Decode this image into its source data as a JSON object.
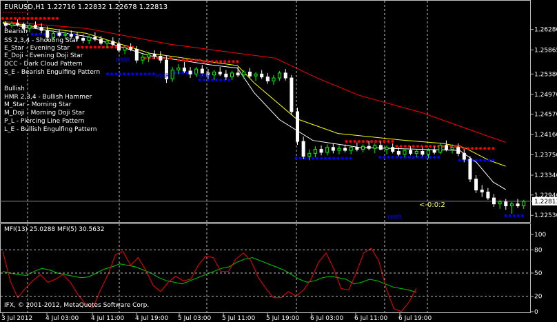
{
  "header": {
    "symbol_line": "EURUSD,H1  1.22716  1.22832  1.22678  1.22813",
    "legend_bearish_title": "Bearish",
    "legend_bearish": [
      "SS 2,3,4 - Shooting Star",
      "E_Star   - Evening Star",
      "E_Doji   - Evening Doji Star",
      "DCC      - Dark Cloud Pattern",
      "S_E      - Bearish Engulfing Pattern"
    ],
    "legend_bullish_title": "Bullish",
    "legend_bullish": [
      "HMR 2,3,4 - Bullish Hammer",
      "M_Star    - Morning Star",
      "M_Doji    - Morning Doji Star",
      "P_L       - Piercing Line Pattern",
      "L_E       - Bullish Engulfing Pattern"
    ],
    "countdown": "<-0:0:2",
    "pattern_tags": [
      "HMR",
      "HMR",
      "HMR",
      "HMR"
    ]
  },
  "indicator": {
    "title": "MFI(13) 25.0288  MFI(5) 30.5632",
    "copyright": "IFX, © 2001-2012, MetaQuotes Software Corp."
  },
  "colors": {
    "background": "#000000",
    "bull_candle": "#00ff00",
    "bear_candle": "#ffffff",
    "red_dots": "#ff0000",
    "blue_dots": "#0000ff",
    "ma_slow": "#ff0000",
    "ma_fast": "#ffffff",
    "ma_mid": "#ffff00",
    "mfi13": "#00cc00",
    "mfi5": "#ff0000"
  },
  "chart_data": [
    {
      "type": "candlestick",
      "title": "EURUSD,H1",
      "ylim": [
        1.2245,
        1.2665
      ],
      "y_ticks": [
        1.2628,
        1.25865,
        1.2538,
        1.2497,
        1.2457,
        1.2416,
        1.2375,
        1.2334,
        1.2294,
        1.22813,
        1.2253
      ],
      "y_tick_labels": [
        "1.26280",
        "1.25865",
        "1.25380",
        "1.24970",
        "1.24570",
        "1.24160",
        "1.23750",
        "1.23340",
        "1.22940",
        "1.22813",
        "1.22530"
      ],
      "current_price": 1.22813,
      "candles": [
        [
          1.264,
          1.2645,
          1.263,
          1.2636
        ],
        [
          1.2636,
          1.2644,
          1.263,
          1.264
        ],
        [
          1.264,
          1.2648,
          1.2634,
          1.2638
        ],
        [
          1.2638,
          1.2642,
          1.2626,
          1.263
        ],
        [
          1.263,
          1.264,
          1.2622,
          1.2636
        ],
        [
          1.2636,
          1.2644,
          1.263,
          1.2632
        ],
        [
          1.2632,
          1.264,
          1.262,
          1.2626
        ],
        [
          1.2626,
          1.2634,
          1.2605,
          1.2612
        ],
        [
          1.2612,
          1.2626,
          1.2606,
          1.262
        ],
        [
          1.262,
          1.2628,
          1.2612,
          1.2616
        ],
        [
          1.2616,
          1.2624,
          1.2608,
          1.2618
        ],
        [
          1.2618,
          1.2626,
          1.261,
          1.2614
        ],
        [
          1.2614,
          1.2622,
          1.2604,
          1.261
        ],
        [
          1.261,
          1.2618,
          1.26,
          1.2606
        ],
        [
          1.2606,
          1.2616,
          1.2598,
          1.2612
        ],
        [
          1.2612,
          1.2622,
          1.2604,
          1.2608
        ],
        [
          1.2608,
          1.2615,
          1.2596,
          1.26
        ],
        [
          1.26,
          1.2608,
          1.259,
          1.2604
        ],
        [
          1.2604,
          1.2612,
          1.2594,
          1.2598
        ],
        [
          1.2598,
          1.2606,
          1.2582,
          1.2586
        ],
        [
          1.2586,
          1.2596,
          1.2578,
          1.2592
        ],
        [
          1.2592,
          1.26,
          1.2584,
          1.2588
        ],
        [
          1.2588,
          1.2594,
          1.256,
          1.2566
        ],
        [
          1.2566,
          1.2578,
          1.2558,
          1.2572
        ],
        [
          1.2572,
          1.2582,
          1.2562,
          1.2578
        ],
        [
          1.2578,
          1.2586,
          1.2568,
          1.2574
        ],
        [
          1.2574,
          1.2584,
          1.256,
          1.2566
        ],
        [
          1.2566,
          1.2574,
          1.252,
          1.2528
        ],
        [
          1.2528,
          1.2552,
          1.2522,
          1.2546
        ],
        [
          1.2546,
          1.2558,
          1.2538,
          1.255
        ],
        [
          1.255,
          1.2562,
          1.254,
          1.2544
        ],
        [
          1.2544,
          1.2552,
          1.253,
          1.2538
        ],
        [
          1.2538,
          1.2552,
          1.2532,
          1.2548
        ],
        [
          1.2548,
          1.2556,
          1.2534,
          1.254
        ],
        [
          1.254,
          1.2548,
          1.2528,
          1.2536
        ],
        [
          1.2536,
          1.2546,
          1.2526,
          1.2542
        ],
        [
          1.2542,
          1.2552,
          1.2534,
          1.2538
        ],
        [
          1.2538,
          1.2546,
          1.2526,
          1.2532
        ],
        [
          1.2532,
          1.2544,
          1.2526,
          1.254
        ],
        [
          1.254,
          1.2552,
          1.2532,
          1.2536
        ],
        [
          1.2536,
          1.2546,
          1.2528,
          1.2542
        ],
        [
          1.2542,
          1.255,
          1.253,
          1.2534
        ],
        [
          1.2534,
          1.2542,
          1.2524,
          1.2538
        ],
        [
          1.2538,
          1.2546,
          1.2528,
          1.2532
        ],
        [
          1.2532,
          1.254,
          1.2518,
          1.2524
        ],
        [
          1.2524,
          1.2536,
          1.2516,
          1.253
        ],
        [
          1.253,
          1.2544,
          1.2524,
          1.254
        ],
        [
          1.254,
          1.2548,
          1.2525,
          1.253
        ],
        [
          1.253,
          1.2536,
          1.2455,
          1.2462
        ],
        [
          1.2462,
          1.247,
          1.2395,
          1.2402
        ],
        [
          1.2402,
          1.2412,
          1.2366,
          1.2372
        ],
        [
          1.2372,
          1.2386,
          1.2364,
          1.2378
        ],
        [
          1.2378,
          1.2392,
          1.237,
          1.2386
        ],
        [
          1.2386,
          1.2394,
          1.2374,
          1.238
        ],
        [
          1.238,
          1.2396,
          1.2374,
          1.239
        ],
        [
          1.239,
          1.2398,
          1.2378,
          1.2384
        ],
        [
          1.2384,
          1.2394,
          1.2376,
          1.2388
        ],
        [
          1.2388,
          1.2396,
          1.238,
          1.2384
        ],
        [
          1.2384,
          1.2392,
          1.2376,
          1.239
        ],
        [
          1.239,
          1.24,
          1.2382,
          1.2386
        ],
        [
          1.2386,
          1.2396,
          1.238,
          1.2392
        ],
        [
          1.2392,
          1.2402,
          1.2384,
          1.2388
        ],
        [
          1.2388,
          1.2398,
          1.2378,
          1.2394
        ],
        [
          1.2394,
          1.2402,
          1.2384,
          1.2386
        ],
        [
          1.2386,
          1.2394,
          1.2376,
          1.239
        ],
        [
          1.239,
          1.2398,
          1.2378,
          1.2382
        ],
        [
          1.2382,
          1.239,
          1.2372,
          1.2376
        ],
        [
          1.2376,
          1.2388,
          1.237,
          1.2384
        ],
        [
          1.2384,
          1.2392,
          1.2374,
          1.2378
        ],
        [
          1.2378,
          1.2386,
          1.237,
          1.2382
        ],
        [
          1.2382,
          1.239,
          1.2372,
          1.2376
        ],
        [
          1.2376,
          1.2388,
          1.2368,
          1.2384
        ],
        [
          1.2384,
          1.2392,
          1.2376,
          1.238
        ],
        [
          1.238,
          1.2398,
          1.2376,
          1.2394
        ],
        [
          1.2394,
          1.2404,
          1.2382,
          1.2386
        ],
        [
          1.2386,
          1.2396,
          1.2378,
          1.239
        ],
        [
          1.239,
          1.2398,
          1.2372,
          1.2378
        ],
        [
          1.2378,
          1.2386,
          1.236,
          1.2366
        ],
        [
          1.2366,
          1.2372,
          1.232,
          1.2326
        ],
        [
          1.2326,
          1.2334,
          1.2298,
          1.2304
        ],
        [
          1.2304,
          1.2314,
          1.229,
          1.23
        ],
        [
          1.23,
          1.2308,
          1.2284,
          1.2288
        ],
        [
          1.2288,
          1.2296,
          1.227,
          1.2276
        ],
        [
          1.2276,
          1.2284,
          1.2266,
          1.228
        ],
        [
          1.228,
          1.2286,
          1.2264,
          1.2272
        ],
        [
          1.2272,
          1.228,
          1.2256,
          1.2276
        ],
        [
          1.2276,
          1.2286,
          1.2268,
          1.2272
        ],
        [
          1.2272,
          1.2284,
          1.2266,
          1.2281
        ]
      ],
      "resistance_dots": [
        [
          0,
          1.265
        ],
        [
          26,
          1.265
        ],
        [
          36,
          1.2592
        ],
        [
          62,
          1.2592
        ],
        [
          68,
          1.257
        ],
        [
          80,
          1.257
        ],
        [
          84,
          1.2566
        ],
        [
          94,
          1.2566
        ],
        [
          96,
          1.2563
        ],
        [
          112,
          1.2563
        ],
        [
          164,
          1.2402
        ],
        [
          186,
          1.2402
        ],
        [
          188,
          1.2392
        ],
        [
          218,
          1.2392
        ],
        [
          220,
          1.2388
        ],
        [
          234,
          1.2388
        ]
      ],
      "support_dots": [
        [
          14,
          1.2618
        ],
        [
          34,
          1.2618
        ],
        [
          50,
          1.2538
        ],
        [
          72,
          1.2538
        ],
        [
          82,
          1.254
        ],
        [
          90,
          1.254
        ],
        [
          94,
          1.2526
        ],
        [
          108,
          1.2526
        ],
        [
          140,
          1.2368
        ],
        [
          166,
          1.2368
        ],
        [
          180,
          1.237
        ],
        [
          208,
          1.237
        ],
        [
          218,
          1.2364
        ],
        [
          234,
          1.2364
        ],
        [
          240,
          1.2252
        ],
        [
          248,
          1.2252
        ]
      ],
      "ma_slow": [
        [
          0,
          1.2644
        ],
        [
          40,
          1.263
        ],
        [
          80,
          1.2598
        ],
        [
          112,
          1.258
        ],
        [
          130,
          1.257
        ],
        [
          150,
          1.253
        ],
        [
          170,
          1.2495
        ],
        [
          200,
          1.246
        ],
        [
          220,
          1.243
        ],
        [
          240,
          1.24
        ]
      ],
      "ma_mid": [
        [
          0,
          1.2642
        ],
        [
          40,
          1.262
        ],
        [
          70,
          1.258
        ],
        [
          100,
          1.2562
        ],
        [
          112,
          1.2555
        ],
        [
          120,
          1.252
        ],
        [
          140,
          1.2448
        ],
        [
          160,
          1.2418
        ],
        [
          190,
          1.2405
        ],
        [
          210,
          1.2398
        ],
        [
          220,
          1.239
        ],
        [
          232,
          1.2364
        ],
        [
          240,
          1.2352
        ]
      ],
      "ma_fast": [
        [
          0,
          1.264
        ],
        [
          40,
          1.2614
        ],
        [
          70,
          1.2575
        ],
        [
          100,
          1.2556
        ],
        [
          112,
          1.255
        ],
        [
          120,
          1.25
        ],
        [
          132,
          1.2446
        ],
        [
          148,
          1.2404
        ],
        [
          170,
          1.239
        ],
        [
          200,
          1.2386
        ],
        [
          218,
          1.2384
        ],
        [
          226,
          1.236
        ],
        [
          234,
          1.232
        ],
        [
          240,
          1.2305
        ]
      ]
    },
    {
      "type": "line",
      "title": "MFI(13) 25.0288  MFI(5) 30.5632",
      "ylim": [
        0,
        100
      ],
      "y_ticks": [
        100,
        80,
        50,
        20,
        0
      ],
      "y_tick_labels": [
        "100",
        "80",
        "50",
        "20",
        "0"
      ],
      "levels": [
        80,
        50,
        20
      ],
      "x_labels": [
        "3 Jul 2012",
        "4 Jul 03:00",
        "4 Jul 11:00",
        "4 Jul 19:00",
        "5 Jul 03:00",
        "5 Jul 11:00",
        "5 Jul 19:00",
        "6 Jul 03:00",
        "6 Jul 11:00",
        "6 Jul 19:00"
      ],
      "series": [
        {
          "name": "MFI(13)",
          "values": [
            52,
            50,
            48,
            47,
            52,
            56,
            54,
            50,
            48,
            46,
            44,
            45,
            50,
            55,
            58,
            62,
            60,
            58,
            54,
            50,
            44,
            40,
            38,
            36,
            40,
            44,
            48,
            52,
            56,
            58,
            64,
            68,
            70,
            66,
            62,
            58,
            54,
            48,
            42,
            38,
            40,
            44,
            46,
            44,
            42,
            36,
            38,
            42,
            40,
            36,
            32,
            30,
            28,
            25
          ]
        },
        {
          "name": "MFI(5)",
          "values": [
            78,
            40,
            18,
            30,
            40,
            48,
            38,
            42,
            48,
            38,
            22,
            10,
            5,
            28,
            48,
            74,
            78,
            60,
            70,
            54,
            34,
            26,
            38,
            46,
            40,
            42,
            60,
            72,
            70,
            52,
            52,
            68,
            76,
            66,
            44,
            30,
            18,
            18,
            26,
            20,
            28,
            42,
            64,
            76,
            56,
            30,
            28,
            50,
            76,
            82,
            66,
            30,
            4,
            0,
            12,
            30
          ]
        }
      ]
    }
  ]
}
